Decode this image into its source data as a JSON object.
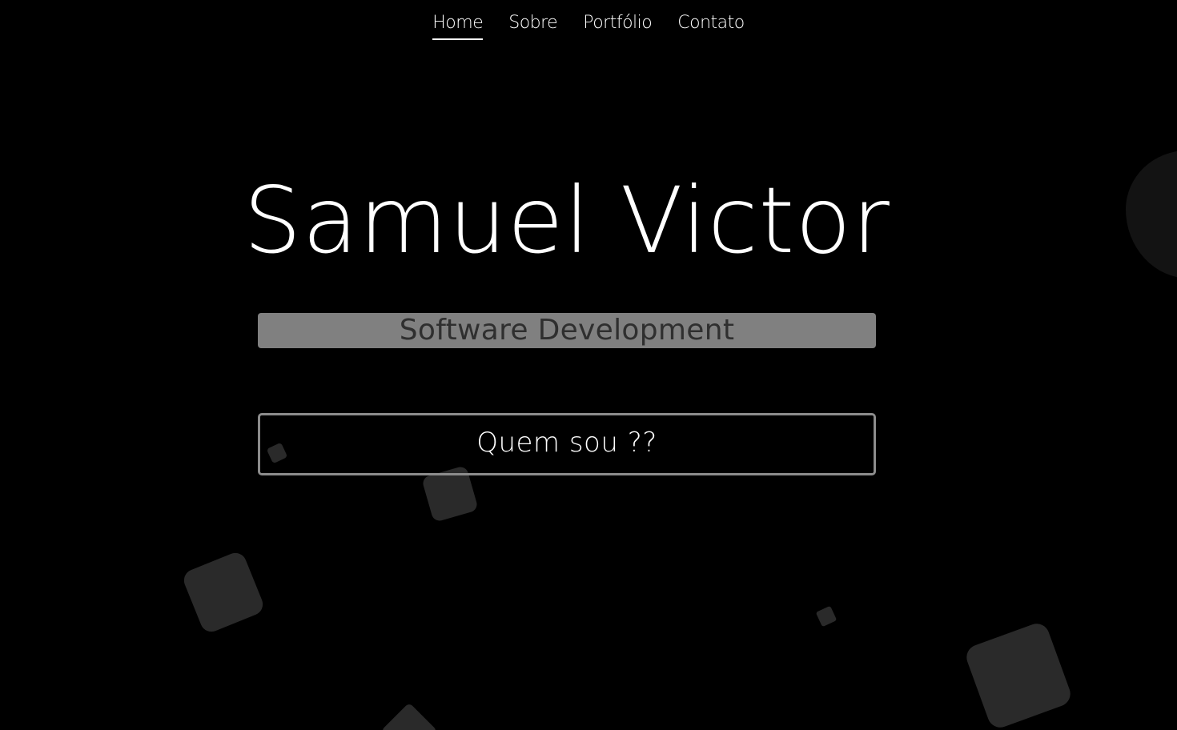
{
  "nav": {
    "items": [
      {
        "label": "Home",
        "active": true
      },
      {
        "label": "Sobre",
        "active": false
      },
      {
        "label": "Portfólio",
        "active": false
      },
      {
        "label": "Contato",
        "active": false
      }
    ]
  },
  "hero": {
    "name": "Samuel Victor",
    "subtitle": "Software Development",
    "cta_label": "Quem sou ??"
  },
  "colors": {
    "background": "#000000",
    "text": "#ffffff",
    "subtitle_bar": "#808080",
    "subtitle_text": "#2f2f2f",
    "button_border": "#8c8c8c",
    "shapes": "#2a2a2a"
  }
}
